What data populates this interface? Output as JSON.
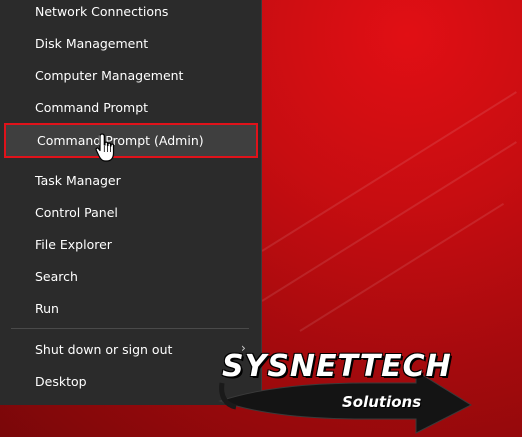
{
  "context_menu": {
    "items": [
      {
        "label": "Network Connections"
      },
      {
        "label": "Disk Management"
      },
      {
        "label": "Computer Management"
      },
      {
        "label": "Command Prompt"
      },
      {
        "label": "Command Prompt (Admin)",
        "highlighted": true
      },
      {
        "label": "Task Manager"
      },
      {
        "label": "Control Panel"
      },
      {
        "label": "File Explorer"
      },
      {
        "label": "Search"
      },
      {
        "label": "Run"
      }
    ],
    "bottom_items": [
      {
        "label": "Shut down or sign out",
        "has_submenu": true
      },
      {
        "label": "Desktop"
      }
    ],
    "submenu_icon": "chevron-right-icon"
  },
  "watermark": {
    "title": "SYSNETTECH",
    "subtitle": "Solutions"
  },
  "colors": {
    "menu_bg": "#2b2b2b",
    "highlight_border": "#e0121a",
    "desktop": "#c70d11",
    "text": "#ffffff"
  },
  "cursor_icon": "hand-pointer-icon"
}
